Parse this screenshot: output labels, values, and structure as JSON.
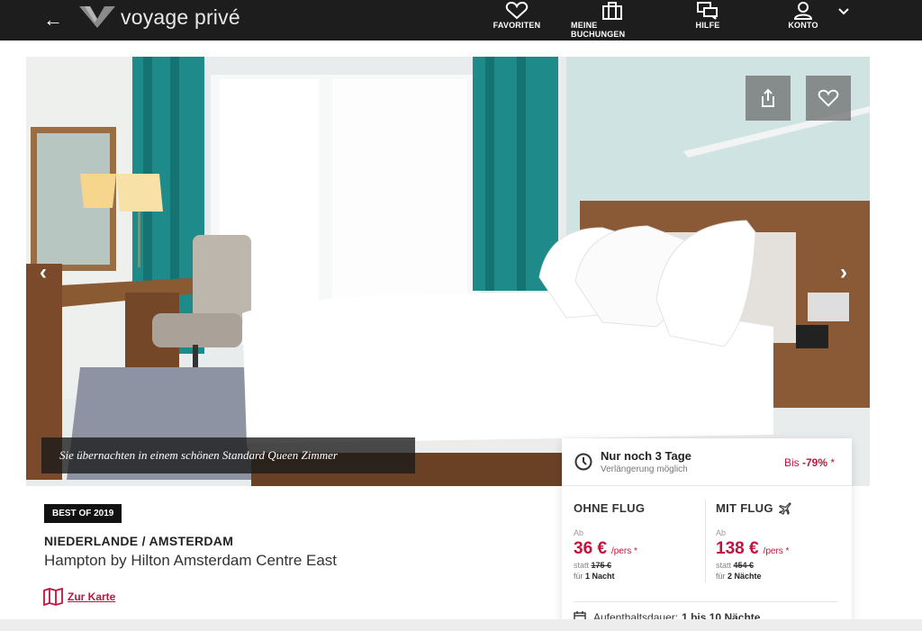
{
  "header": {
    "logo_text": "voyage privé",
    "nav": [
      {
        "label": "FAVORITEN",
        "icon": "heart-icon"
      },
      {
        "label": "MEINE BUCHUNGEN",
        "icon": "suitcase-icon"
      },
      {
        "label": "HILFE",
        "icon": "chat-icon"
      },
      {
        "label": "KONTO",
        "icon": "user-icon"
      }
    ]
  },
  "hero": {
    "caption": "Sie übernachten in einem schönen Standard Queen Zimmer"
  },
  "offer": {
    "badge": "BEST OF 2019",
    "destination": "NIEDERLANDE / AMSTERDAM",
    "hotel_name": "Hampton by Hilton Amsterdam Centre East",
    "map_link": "Zur Karte"
  },
  "pricebox": {
    "title": "Nur noch 3 Tage",
    "subtitle": "Verlängerung möglich",
    "discount_prefix": "Bis",
    "discount_value": "-79%",
    "discount_suffix": "*",
    "ohne_flug": {
      "heading": "OHNE FLUG",
      "ab": "Ab",
      "price": "36 €",
      "unit": "/pers *",
      "statt_label": "statt",
      "old_price": "175 €",
      "fuer_label": "für",
      "nights": "1 Nacht"
    },
    "mit_flug": {
      "heading": "MIT FLUG",
      "ab": "Ab",
      "price": "138 €",
      "unit": "/pers *",
      "statt_label": "statt",
      "old_price": "454 €",
      "fuer_label": "für",
      "nights": "2 Nächte"
    },
    "stay_label": "Aufenthaltsdauer:",
    "stay_value": "1 bis 10 Nächte"
  },
  "colors": {
    "accent": "#c4123e",
    "header_bg": "#1d1d1d"
  }
}
